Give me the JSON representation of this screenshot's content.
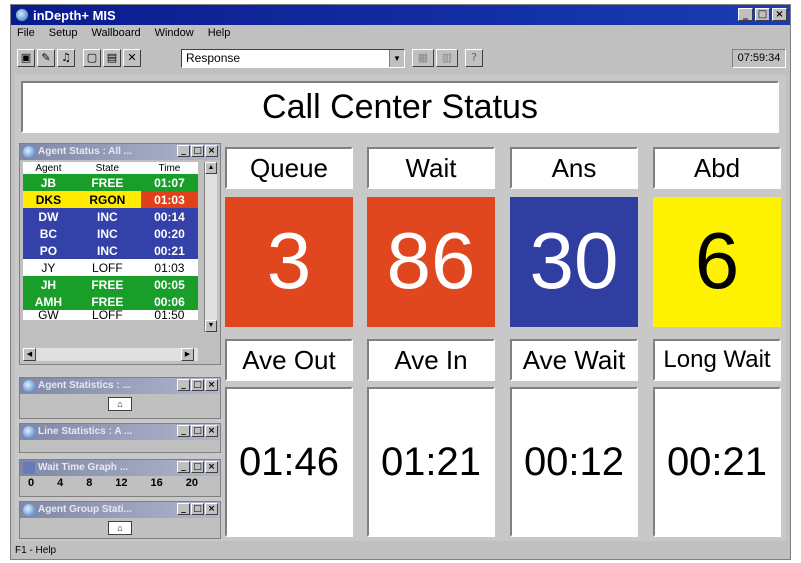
{
  "window": {
    "title": "inDepth+ MIS",
    "min": "_",
    "max": "□",
    "close": "×"
  },
  "menu": [
    "File",
    "Setup",
    "Wallboard",
    "Window",
    "Help"
  ],
  "toolbar": {
    "combo_value": "Response",
    "clock": "07:59:34"
  },
  "banner": "Call Center Status",
  "agent_status": {
    "title": "Agent Status : All ...",
    "headers": [
      "Agent",
      "State",
      "Time"
    ],
    "rows": [
      {
        "agent": "JB",
        "state": "FREE",
        "time": "01:07",
        "kind": "free"
      },
      {
        "agent": "DKS",
        "state": "RGON",
        "time": "01:03",
        "kind": "rgon"
      },
      {
        "agent": "DW",
        "state": "INC",
        "time": "00:14",
        "kind": "inc"
      },
      {
        "agent": "BC",
        "state": "INC",
        "time": "00:20",
        "kind": "inc"
      },
      {
        "agent": "PO",
        "state": "INC",
        "time": "00:21",
        "kind": "inc"
      },
      {
        "agent": "JY",
        "state": "LOFF",
        "time": "01:03",
        "kind": "loff"
      },
      {
        "agent": "JH",
        "state": "FREE",
        "time": "00:05",
        "kind": "free"
      },
      {
        "agent": "AMH",
        "state": "FREE",
        "time": "00:06",
        "kind": "free"
      },
      {
        "agent": "GW",
        "state": "LOFF",
        "time": "01:50",
        "kind": "loff"
      }
    ]
  },
  "agent_statistics": {
    "title": "Agent Statistics : ..."
  },
  "line_statistics": {
    "title": "Line Statistics : A ..."
  },
  "wait_time_graph": {
    "title": "Wait Time Graph ...",
    "axis": [
      "0",
      "4",
      "8",
      "12",
      "16",
      "20"
    ]
  },
  "agent_group_statistics": {
    "title": "Agent Group Stati..."
  },
  "tiles_top": [
    {
      "label": "Queue",
      "value": "3",
      "bg": "#e0471e",
      "fg": "#ffffff"
    },
    {
      "label": "Wait",
      "value": "86",
      "bg": "#e0471e",
      "fg": "#ffffff"
    },
    {
      "label": "Ans",
      "value": "30",
      "bg": "#2f3ea0",
      "fg": "#ffffff"
    },
    {
      "label": "Abd",
      "value": "6",
      "bg": "#fff200",
      "fg": "#000000"
    }
  ],
  "tiles_bottom": [
    {
      "label": "Ave Out",
      "value": "01:46"
    },
    {
      "label": "Ave In",
      "value": "01:21"
    },
    {
      "label": "Ave Wait",
      "value": "00:12"
    },
    {
      "label": "Long Wait",
      "value": "00:21"
    }
  ],
  "status": "F1 - Help"
}
